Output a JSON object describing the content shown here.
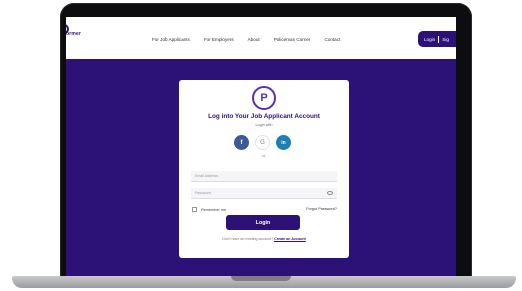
{
  "header": {
    "logo_text": "ormer",
    "nav": [
      {
        "label": "For Job Applicants"
      },
      {
        "label": "For Employers"
      },
      {
        "label": "About"
      },
      {
        "label": "Policeman Corner"
      },
      {
        "label": "Contact"
      }
    ],
    "login_label": "Login",
    "signup_partial": "Sig"
  },
  "card": {
    "logo_glyph": "P",
    "title": "Log into Your Job Applicant Account",
    "subtitle": "Login with",
    "social": {
      "facebook": "f",
      "google": "G",
      "linkedin": "in"
    },
    "or_text": "or",
    "email_placeholder": "Email Address",
    "password_placeholder": "Password",
    "remember_label": "Remember me",
    "forgot_label": "Forgot Password?",
    "login_button": "Login",
    "signup_prompt": "Don't have an existing account? ",
    "signup_link": "Create an Account"
  },
  "colors": {
    "brand": "#2c1277",
    "accent": "#5b2fb3",
    "facebook": "#3b5b98",
    "linkedin": "#1e7fb4"
  }
}
